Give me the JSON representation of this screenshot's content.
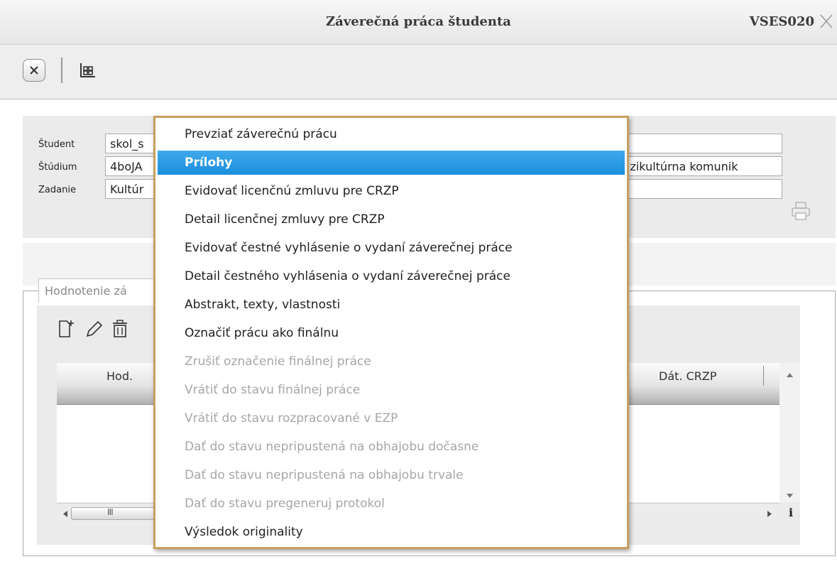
{
  "window": {
    "title": "Záverečná práca študenta",
    "code": "VSES020"
  },
  "form": {
    "student_label": "Študent",
    "student_value": "skol_s",
    "study_label": "Štúdium",
    "study_value": "4boJA",
    "study_value_right": "lzikultúrna komunik",
    "assignment_label": "Zadanie",
    "assignment_value": "Kultúr"
  },
  "tab": {
    "label": "Hodnotenie zá"
  },
  "grid": {
    "columns": [
      "Hod.",
      "Dát. CRZP"
    ],
    "hscroll_grip": "III",
    "info": "i"
  },
  "context_menu": {
    "items": [
      {
        "label": "Prevziať záverečnú prácu",
        "state": "enabled"
      },
      {
        "label": "Prílohy",
        "state": "highlighted"
      },
      {
        "label": "Evidovať licenčnú zmluvu pre CRZP",
        "state": "enabled"
      },
      {
        "label": "Detail licenčnej zmluvy pre CRZP",
        "state": "enabled"
      },
      {
        "label": "Evidovať čestné vyhlásenie o vydaní záverečnej práce",
        "state": "enabled"
      },
      {
        "label": "Detail čestného vyhlásenia o vydaní záverečnej práce",
        "state": "enabled"
      },
      {
        "label": "Abstrakt, texty, vlastnosti",
        "state": "enabled"
      },
      {
        "label": "Označiť prácu ako finálnu",
        "state": "enabled"
      },
      {
        "label": "Zrušiť označenie finálnej práce",
        "state": "disabled"
      },
      {
        "label": "Vrátiť do stavu finálnej práce",
        "state": "disabled"
      },
      {
        "label": "Vrátiť do stavu rozpracované v EZP",
        "state": "disabled"
      },
      {
        "label": "Dať do stavu nepripustená na obhajobu dočasne",
        "state": "disabled"
      },
      {
        "label": "Dať do stavu nepripustená na obhajobu trvale",
        "state": "disabled"
      },
      {
        "label": "Dať do stavu pregeneruj protokol",
        "state": "disabled"
      },
      {
        "label": "Výsledok originality",
        "state": "enabled"
      }
    ]
  },
  "colors": {
    "highlight": "#1a8fdd",
    "menu_border": "#c79f5e",
    "disabled_text": "#a6a6a6"
  },
  "icons": [
    "close-icon",
    "window-close-icon",
    "hierarchy-icon",
    "new-document-icon",
    "edit-pencil-icon",
    "delete-trash-icon",
    "print-icon",
    "scroll-up-icon",
    "scroll-down-icon",
    "scroll-left-icon",
    "scroll-right-icon",
    "info-icon"
  ]
}
